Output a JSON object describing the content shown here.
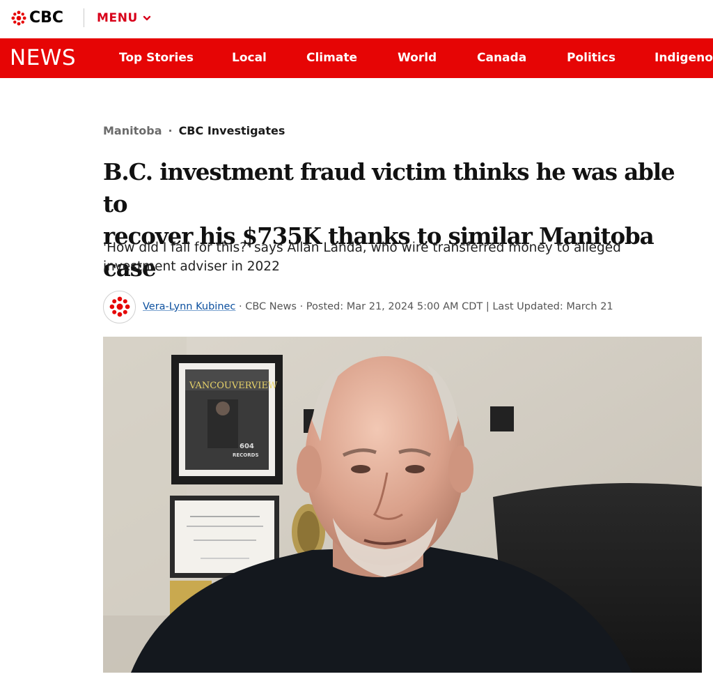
{
  "header": {
    "logo_text": "CBC",
    "menu_label": "MENU"
  },
  "news_nav": {
    "brand": "NEWS",
    "items": [
      "Top Stories",
      "Local",
      "Climate",
      "World",
      "Canada",
      "Politics",
      "Indigeno"
    ]
  },
  "article": {
    "section": "Manitoba",
    "separator": "·",
    "series": "CBC Investigates",
    "headline_line1": "B.C. investment fraud victim thinks he was able to",
    "headline_line2": "recover his $735K thanks to similar Manitoba case",
    "deck_line1": "'How did I fall for this?' says Allan Landa, who wire transferred money to alleged",
    "deck_line2": "investment adviser in 2022",
    "author": "Vera-Lynn Kubinec",
    "byline_rest": " · CBC News · Posted: Mar 21, 2024 5:00 AM CDT | Last Updated: March 21"
  },
  "photo": {
    "poster_text_1": "VANCOUVERVIEW",
    "poster_text_2": "604",
    "poster_text_3": "RECORDS"
  },
  "colors": {
    "brand_red": "#e60505",
    "menu_red": "#d8001a",
    "link_blue": "#0b4f9e"
  },
  "icons": {
    "logo": "cbc-gem-icon",
    "menu": "chevron-down-icon",
    "avatar": "cbc-gem-icon"
  }
}
